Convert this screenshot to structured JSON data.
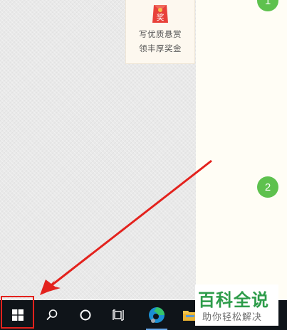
{
  "reward_card": {
    "badge_char": "奖",
    "line1": "写优质悬赏",
    "line2": "领丰厚奖金"
  },
  "steps": {
    "step1": "1",
    "step2": "2"
  },
  "taskbar": {
    "items": [
      "start-icon",
      "search-icon",
      "cortana-icon",
      "task-view-icon",
      "edge-icon",
      "file-explorer-icon"
    ]
  },
  "watermark": {
    "title": "百科全说",
    "subtitle": "助你轻松解决"
  },
  "colors": {
    "accent_green": "#5ec14e",
    "highlight_red": "#e3221d",
    "taskbar": "#0f1419"
  }
}
